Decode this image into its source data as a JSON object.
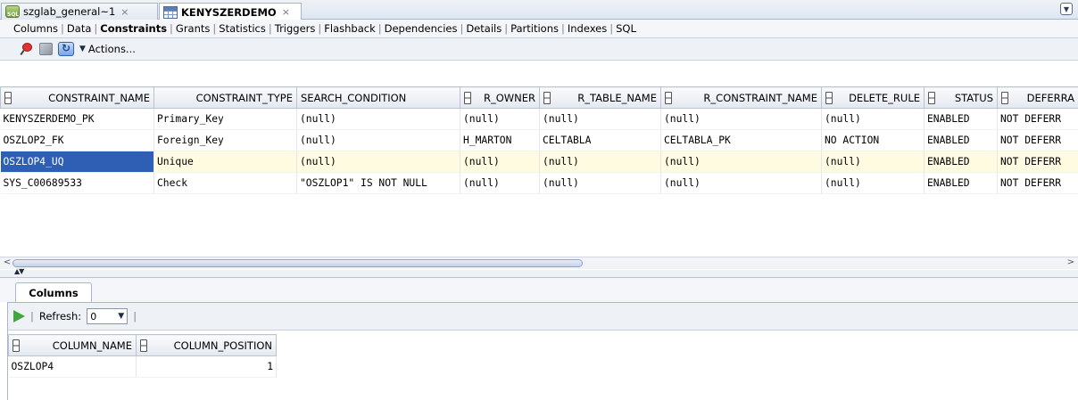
{
  "doc_tabs": [
    {
      "label": "szglab_general~1",
      "close": "×",
      "icon": "sql-worksheet-icon"
    },
    {
      "label": "KENYSZERDEMO",
      "close": "×",
      "icon": "table-icon"
    }
  ],
  "sub_tabs": [
    "Columns",
    "Data",
    "Constraints",
    "Grants",
    "Statistics",
    "Triggers",
    "Flashback",
    "Dependencies",
    "Details",
    "Partitions",
    "Indexes",
    "SQL"
  ],
  "active_sub_tab": "Constraints",
  "toolbar": {
    "actions_label": "Actions..."
  },
  "constraints": {
    "headers": [
      "CONSTRAINT_NAME",
      "CONSTRAINT_TYPE",
      "SEARCH_CONDITION",
      "R_OWNER",
      "R_TABLE_NAME",
      "R_CONSTRAINT_NAME",
      "DELETE_RULE",
      "STATUS",
      "DEFERRA"
    ],
    "rows": [
      [
        "KENYSZERDEMO_PK",
        "Primary_Key",
        "(null)",
        "(null)",
        "(null)",
        "(null)",
        "(null)",
        "ENABLED",
        "NOT DEFERR"
      ],
      [
        "OSZLOP2_FK",
        "Foreign_Key",
        "(null)",
        "H_MARTON",
        "CELTABLA",
        "CELTABLA_PK",
        "NO ACTION",
        "ENABLED",
        "NOT DEFERR"
      ],
      [
        "OSZLOP4_UQ",
        "Unique",
        "(null)",
        "(null)",
        "(null)",
        "(null)",
        "(null)",
        "ENABLED",
        "NOT DEFERR"
      ],
      [
        "SYS_C00689533",
        "Check",
        "\"OSZLOP1\" IS NOT NULL",
        "(null)",
        "(null)",
        "(null)",
        "(null)",
        "ENABLED",
        "NOT DEFERR"
      ]
    ]
  },
  "bottom": {
    "tab_label": "Columns",
    "refresh_label": "Refresh:",
    "refresh_value": "0",
    "headers": [
      "COLUMN_NAME",
      "COLUMN_POSITION"
    ],
    "rows": [
      [
        "OSZLOP4",
        "1"
      ]
    ]
  },
  "colors": {
    "selection": "#2e5fb4",
    "accent": "#a9b7cc"
  }
}
